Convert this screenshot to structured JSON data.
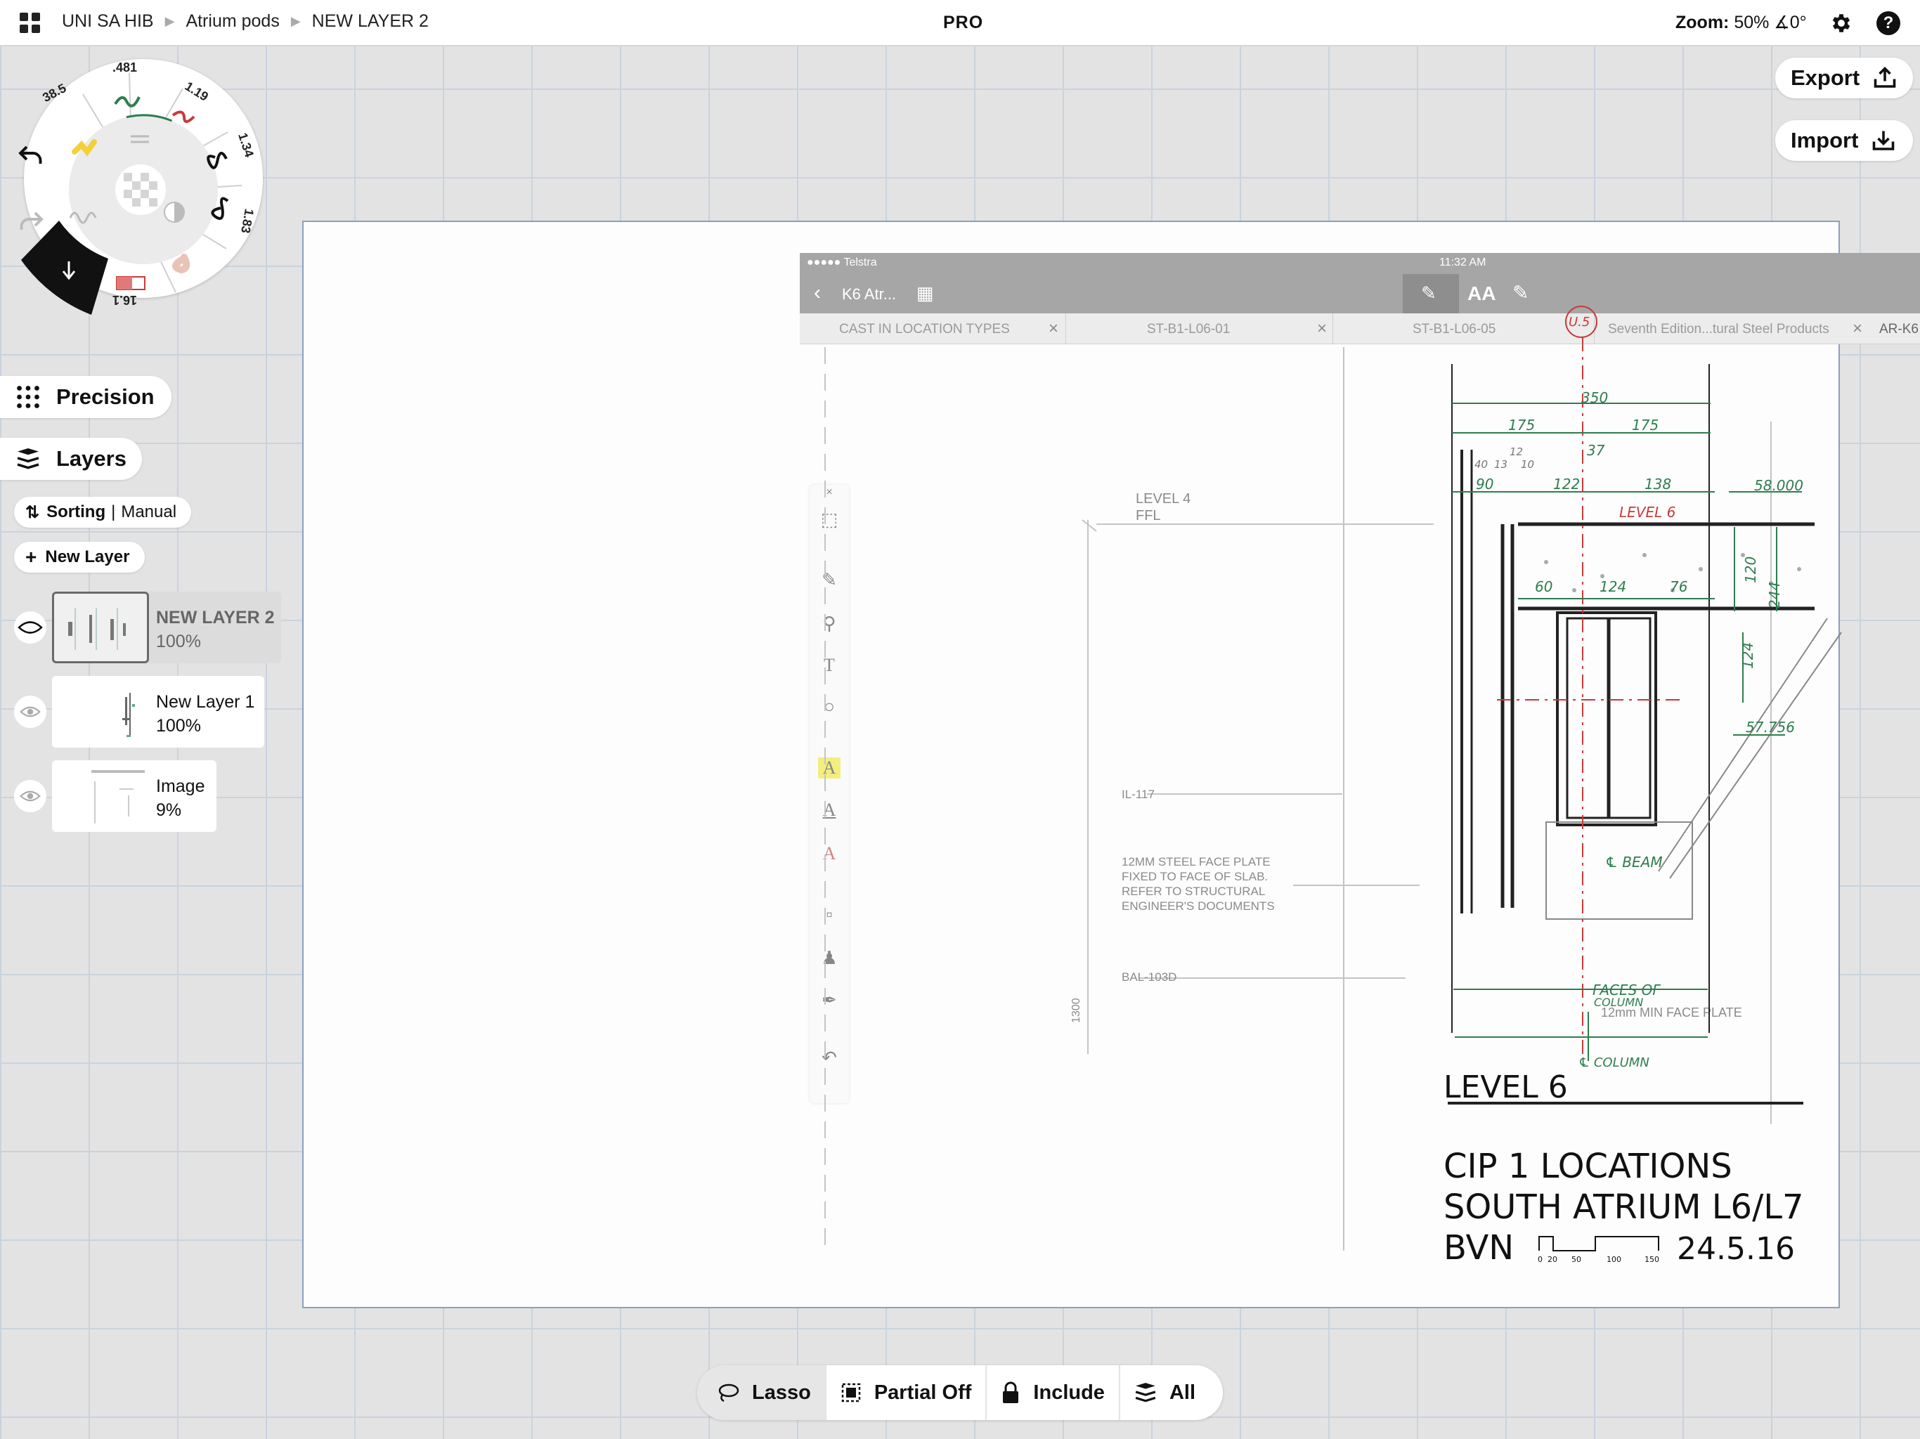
{
  "topbar": {
    "breadcrumbs": [
      "UNI SA HIB",
      "Atrium pods",
      "NEW LAYER 2"
    ],
    "badge": "PRO",
    "zoom_label": "Zoom:",
    "zoom_value": "50% ∡0°"
  },
  "actions": {
    "export_label": "Export",
    "import_label": "Import"
  },
  "wheel": {
    "sizes": [
      "38.5",
      ".481",
      "1.19",
      "1.34",
      "1.83",
      "16.1"
    ],
    "colors": [
      "#f2d13a",
      "#2e7d4f",
      "#c83a3a",
      "#111111",
      "#111111",
      "#e07a7a"
    ]
  },
  "sidebar": {
    "precision_label": "Precision",
    "layers_label": "Layers",
    "sorting_label": "Sorting",
    "sorting_value": "Manual",
    "new_layer_label": "New Layer",
    "layers": [
      {
        "name": "NEW LAYER 2",
        "opacity": "100%"
      },
      {
        "name": "New Layer 1",
        "opacity": "100%"
      },
      {
        "name": "Image",
        "opacity": "9%"
      }
    ]
  },
  "embedded": {
    "carrier": "●●●●● Telstra",
    "time": "11:32 AM",
    "doc_title": "K6 Atr...",
    "tabs": [
      "CAST IN LOCATION TYPES",
      "ST-B1-L06-01",
      "ST-B1-L06-05",
      "Seventh Edition...tural Steel Products",
      "AR-K6"
    ],
    "annotations": {
      "level4": "LEVEL 4",
      "ffl": "FFL",
      "il117": "IL-117",
      "note1": "12MM STEEL FACE PLATE",
      "note2": "FIXED TO FACE OF SLAB.",
      "note3": "REFER TO STRUCTURAL",
      "note4": "ENGINEER'S DOCUMENTS",
      "bal": "BAL-103D",
      "dim1300": "1300",
      "faceplate": "12mm MIN FACE PLATE"
    },
    "hand": {
      "d350": "350",
      "d175a": "175",
      "d175b": "175",
      "d37": "37",
      "d40": "40",
      "d13": "13",
      "d12": "12",
      "d10": "10",
      "d90": "90",
      "d122": "122",
      "d138": "138",
      "d58": "58.000",
      "level6red": "LEVEL 6",
      "d60": "60",
      "d124a": "124",
      "d76": "76",
      "d120": "120",
      "d244": "244",
      "d124b": "124",
      "d57": "57.756",
      "cbeam": "℄ BEAM",
      "faces1": "FACES OF",
      "faces2": "COLUMN",
      "ccol": "℄ COLUMN",
      "us": "U.5",
      "level6": "LEVEL 6",
      "title1": "CIP 1 LOCATIONS",
      "title2": "SOUTH ATRIUM L6/L7",
      "title3a": "BVN",
      "title3b": "24.5.16",
      "scale": [
        "0",
        "20",
        "50",
        "100",
        "150"
      ]
    }
  },
  "bottombar": {
    "lasso": "Lasso",
    "partial": "Partial Off",
    "include": "Include",
    "all": "All"
  }
}
